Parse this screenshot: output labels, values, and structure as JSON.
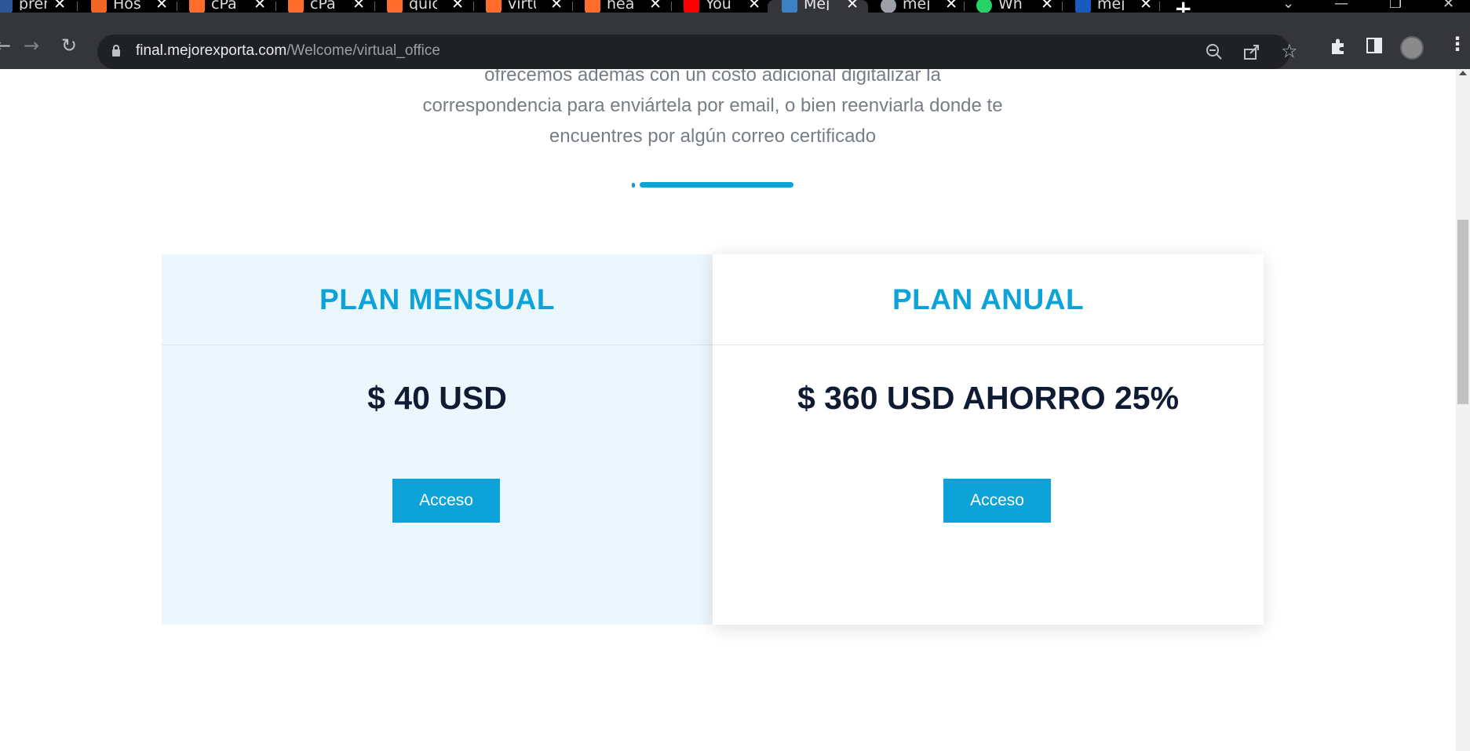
{
  "browser": {
    "tabs": [
      {
        "title": "pren",
        "favicon_color": "#2b579a",
        "active": false
      },
      {
        "title": "Hos",
        "favicon_color": "#f26522",
        "active": false
      },
      {
        "title": "cPa",
        "favicon_color": "#ff6c2c",
        "active": false
      },
      {
        "title": "cPa",
        "favicon_color": "#ff6c2c",
        "active": false
      },
      {
        "title": "quic",
        "favicon_color": "#ff6c2c",
        "active": false
      },
      {
        "title": "virtu",
        "favicon_color": "#ff6c2c",
        "active": false
      },
      {
        "title": "hea",
        "favicon_color": "#ff6c2c",
        "active": false
      },
      {
        "title": "You",
        "favicon_color": "#ff0000",
        "active": false
      },
      {
        "title": "Mej",
        "favicon_color": "#3b82c4",
        "active": true
      },
      {
        "title": "mej",
        "favicon_color": "#9aa0a6",
        "active": false
      },
      {
        "title": "Wh",
        "favicon_color": "#25d366",
        "active": false
      },
      {
        "title": "mej",
        "favicon_color": "#185abd",
        "active": false
      }
    ],
    "close_glyph": "✕",
    "new_tab_glyph": "+",
    "url_host": "final.mejorexporta.com",
    "url_path": "/Welcome/virtual_office"
  },
  "page": {
    "intro_lines": [
      "ofrecemos además con un costo adicional digitalizar la",
      "correspondencia para enviártela por email, o bien reenviarla donde te",
      "encuentres por algún correo certificado"
    ],
    "plans": {
      "monthly": {
        "title": "PLAN MENSUAL",
        "price": "$ 40 USD",
        "button": "Acceso"
      },
      "annual": {
        "title": "PLAN ANUAL",
        "price": "$ 360 USD AHORRO 25%",
        "button": "Acceso"
      }
    }
  },
  "colors": {
    "accent": "#0ea3d8",
    "monthly_bg": "#ebf7fd",
    "price_text": "#0f1a33"
  }
}
